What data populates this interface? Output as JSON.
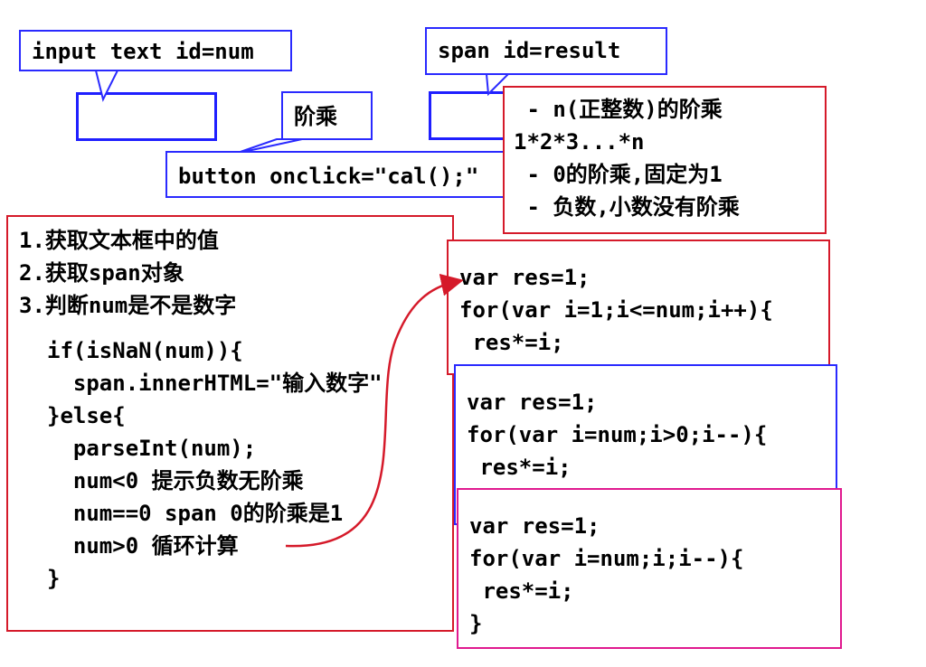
{
  "callouts": {
    "input_label": "input text id=num",
    "span_label": "span id=result",
    "button_label": "阶乘",
    "button_code": "button onclick=\"cal();\""
  },
  "rules": {
    "lines": [
      " - n(正整数)的阶乘",
      "1*2*3...*n",
      " - 0的阶乘,固定为1",
      " - 负数,小数没有阶乘"
    ]
  },
  "steps": {
    "lines": [
      "1.获取文本框中的值",
      "2.获取span对象",
      "3.判断num是不是数字"
    ],
    "code": [
      "if(isNaN(num)){",
      "  span.innerHTML=\"输入数字\"",
      "}else{",
      "  parseInt(num);",
      "  num<0 提示负数无阶乘",
      "  num==0 span 0的阶乘是1",
      "  num>0 循环计算",
      "}"
    ]
  },
  "loops": {
    "red": [
      "var res=1;",
      "for(var i=1;i<=num;i++){",
      " res*=i;",
      "}"
    ],
    "blue": [
      "var res=1;",
      "for(var i=num;i>0;i--){",
      " res*=i;"
    ],
    "magenta": [
      "var res=1;",
      "for(var i=num;i;i--){",
      " res*=i;",
      "}"
    ]
  },
  "colors": {
    "blue_border": "#2a2aff",
    "red_border": "#d51a2a",
    "magenta_border": "#e0198f",
    "arrow": "#d51a2a"
  }
}
